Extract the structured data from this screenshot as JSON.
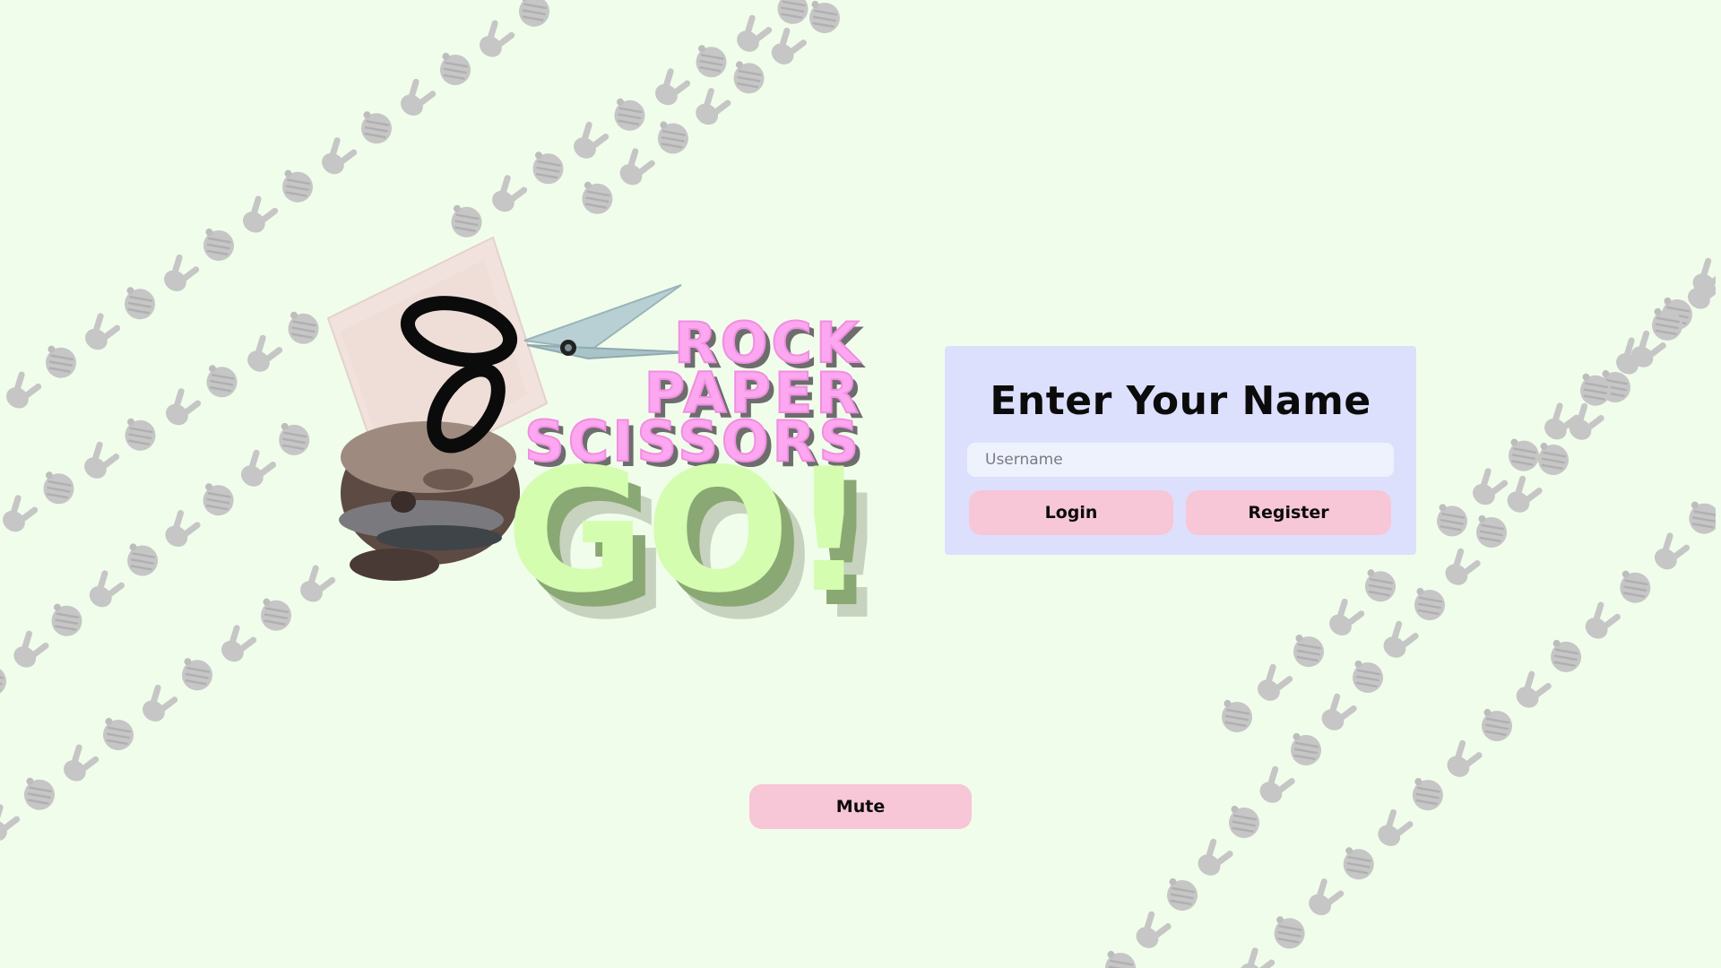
{
  "logo": {
    "line1": "ROCK",
    "line2": "PAPER",
    "line3": "SCISSORS",
    "line4": "GO!"
  },
  "login_panel": {
    "title": "Enter Your Name",
    "username_placeholder": "Username",
    "username_value": "",
    "login_label": "Login",
    "register_label": "Register"
  },
  "controls": {
    "mute_label": "Mute"
  },
  "colors": {
    "background": "#f1fdeb",
    "panel": "#dce0fc",
    "button": "#f7c6d7",
    "logo_pink": "#fca7f0",
    "logo_green": "#d4fdb0",
    "pattern_gray": "#c9c9c9"
  },
  "icons": {
    "pattern": [
      "rock-fist-icon",
      "peace-hand-icon"
    ],
    "logo": [
      "scissors-icon",
      "paper-sheet-icon",
      "rock-stone-icon"
    ]
  }
}
